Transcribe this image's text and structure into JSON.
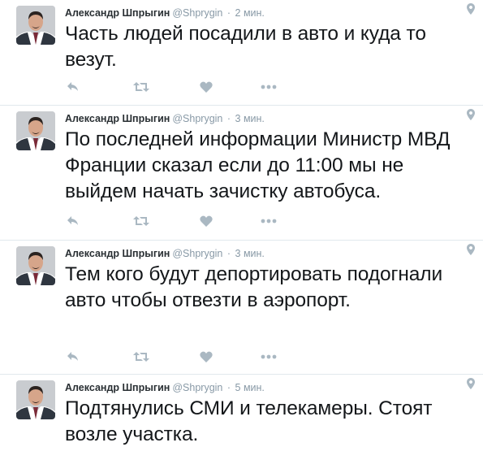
{
  "tweets": [
    {
      "author": "Александр Шпрыгин",
      "handle": "@Shprygin",
      "separator": "·",
      "time": "2 мин.",
      "text": "Часть людей посадили в авто и куда то везут."
    },
    {
      "author": "Александр Шпрыгин",
      "handle": "@Shprygin",
      "separator": "·",
      "time": "3 мин.",
      "text": "По последней информации Министр МВД Франции сказал если до 11:00 мы не выйдем начать зачистку автобуса."
    },
    {
      "author": "Александр Шпрыгин",
      "handle": "@Shprygin",
      "separator": "·",
      "time": "3 мин.",
      "text": "Тем кого будут депортировать подогнали авто чтобы отвезти в аэропорт."
    },
    {
      "author": "Александр Шпрыгин",
      "handle": "@Shprygin",
      "separator": "·",
      "time": "5 мин.",
      "text": "Подтянулись СМИ и телекамеры. Стоят возле участка."
    }
  ],
  "icons": {
    "reply": "reply-icon",
    "retweet": "retweet-icon",
    "like": "heart-icon",
    "more": "more-icon",
    "geo": "location-pin-icon"
  },
  "colors": {
    "name": "#292f33",
    "meta": "#8899a6",
    "icon": "#aab8c2",
    "divider": "#e1e8ed"
  }
}
